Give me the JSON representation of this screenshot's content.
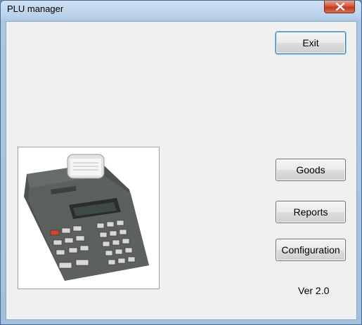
{
  "window": {
    "title": "PLU manager"
  },
  "buttons": {
    "exit": "Exit",
    "goods": "Goods",
    "reports": "Reports",
    "configuration": "Configuration"
  },
  "version": "Ver 2.0",
  "icons": {
    "close": "close-icon",
    "device": "cash-register-image"
  },
  "colors": {
    "titlebar": "#b9d1ea",
    "close_button": "#c23b1e",
    "client_bg": "#f0f0f0",
    "device_body": "#5a5f5c"
  }
}
